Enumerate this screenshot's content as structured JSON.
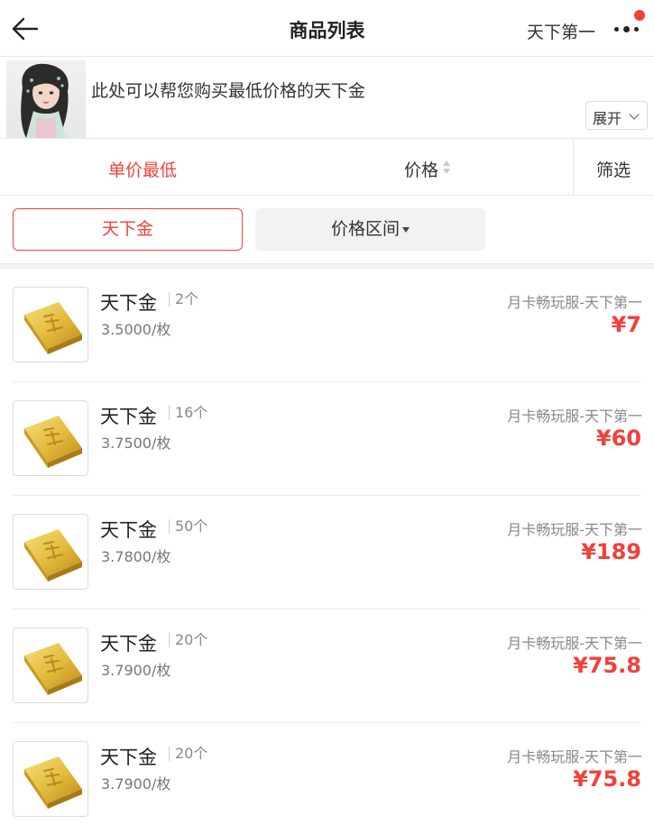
{
  "header": {
    "title": "商品列表",
    "server_name": "天下第一"
  },
  "banner": {
    "text": "此处可以帮您购买最低价格的天下金",
    "expand_label": "展开"
  },
  "sort": {
    "unit_price_lowest": "单价最低",
    "price": "价格",
    "filter": "筛选"
  },
  "chips": {
    "gold": "天下金",
    "price_range": "价格区间"
  },
  "colors": {
    "accent": "#f0413b",
    "text": "#333333",
    "muted": "#888888"
  },
  "items": [
    {
      "name": "天下金",
      "count": "2个",
      "unit_price": "3.5000/枚",
      "server": "月卡畅玩服-天下第一",
      "price": "¥7"
    },
    {
      "name": "天下金",
      "count": "16个",
      "unit_price": "3.7500/枚",
      "server": "月卡畅玩服-天下第一",
      "price": "¥60"
    },
    {
      "name": "天下金",
      "count": "50个",
      "unit_price": "3.7800/枚",
      "server": "月卡畅玩服-天下第一",
      "price": "¥189"
    },
    {
      "name": "天下金",
      "count": "20个",
      "unit_price": "3.7900/枚",
      "server": "月卡畅玩服-天下第一",
      "price": "¥75.8"
    },
    {
      "name": "天下金",
      "count": "20个",
      "unit_price": "3.7900/枚",
      "server": "月卡畅玩服-天下第一",
      "price": "¥75.8"
    }
  ]
}
